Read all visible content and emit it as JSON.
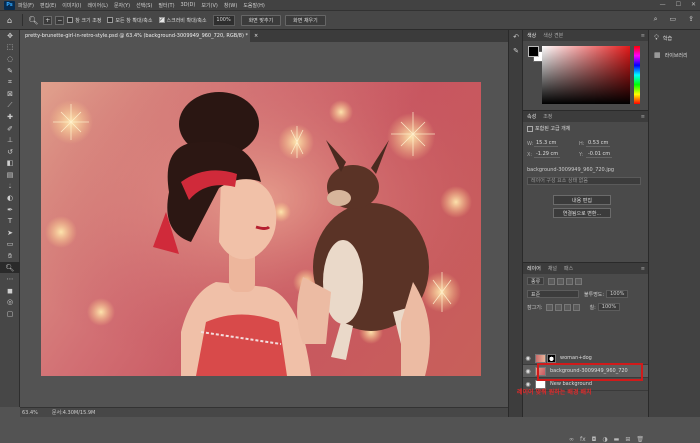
{
  "menubar": {
    "logo": "Ps",
    "items": [
      "파일(F)",
      "편집(E)",
      "이미지(I)",
      "레이어(L)",
      "문자(Y)",
      "선택(S)",
      "필터(T)",
      "3D(D)",
      "보기(V)",
      "창(W)",
      "도움말(H)"
    ],
    "window_controls": [
      "—",
      "☐",
      "✕"
    ]
  },
  "options": {
    "resize_windows": "창 크기 조정",
    "zoom_all": "모든 창 확대/축소",
    "scrubby_zoom": "스크러비 확대/축소",
    "zoom_value": "100%",
    "fit_screen": "화면 맞추기",
    "fill_screen": "화면 채우기"
  },
  "tab": {
    "title": "pretty-brunette-girl-in-retro-style.psd @ 63.4% (background-3009949_960_720, RGB/8) *",
    "close": "×"
  },
  "status": {
    "zoom": "63.4%",
    "doc": "문서:4.30M/15.9M"
  },
  "color_panel": {
    "tabs": [
      "색상",
      "색상 견본"
    ]
  },
  "properties_panel": {
    "tabs": [
      "속성",
      "조정"
    ],
    "subtabs": [
      "포함된 고급 개체"
    ],
    "w_label": "W:",
    "w_value": "15.3 cm",
    "h_label": "H:",
    "h_value": "0.53 cm",
    "x_label": "X:",
    "x_value": "-1.29 cm",
    "y_label": "Y:",
    "y_value": "-0.01 cm",
    "filename": "background-3009949_960_720.jpg",
    "layer_comp": "레이어 구성 요소 상태 없음",
    "edit_contents": "내용 편집",
    "convert_linked": "연결됨으로 변환..."
  },
  "layers_panel": {
    "tabs": [
      "레이어",
      "채널",
      "패스"
    ],
    "kind": "종류",
    "blend": "표준",
    "opacity_label": "불투명도:",
    "opacity_value": "100%",
    "lock_label": "잠그기:",
    "fill_label": "칠:",
    "fill_value": "100%",
    "layers": [
      {
        "name": "woman+dog"
      },
      {
        "name": "background-3009949_960_720"
      },
      {
        "name": "New background"
      }
    ],
    "annotation": "레이어 맞춰 원하는 배경 배치"
  },
  "right_dock": {
    "items": [
      "학습",
      "라이브러리"
    ]
  },
  "colors": {
    "accent": "#31a8ff",
    "annotation_red": "#d11a1a",
    "canvas_bg": "#535353"
  }
}
